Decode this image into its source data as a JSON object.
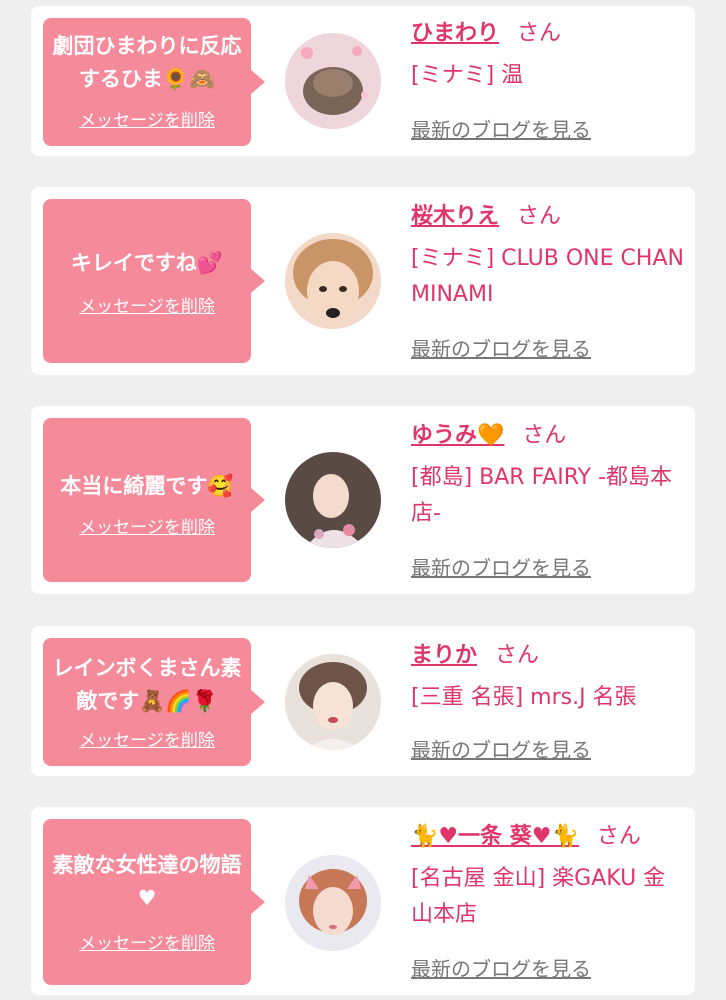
{
  "accent_color": "#e0356b",
  "bubble_color": "#f58a9a",
  "items": [
    {
      "message": "劇団ひまわりに反応するひま🌻🙈",
      "delete_label": "メッセージを削除",
      "name": "ひまわり",
      "honorific": "さん",
      "shop": "[ミナミ] 温",
      "blog_label": "最新のブログを見る"
    },
    {
      "message": "キレイですね💕",
      "delete_label": "メッセージを削除",
      "name": "桜木りえ",
      "honorific": "さん",
      "shop": "[ミナミ] CLUB ONE CHAN MINAMI",
      "blog_label": "最新のブログを見る"
    },
    {
      "message": "本当に綺麗です🥰",
      "delete_label": "メッセージを削除",
      "name": "ゆうみ🧡",
      "honorific": "さん",
      "shop": "[都島] BAR FAIRY -都島本店-",
      "blog_label": "最新のブログを見る"
    },
    {
      "message": "レインボくまさん素敵です🧸🌈🌹",
      "delete_label": "メッセージを削除",
      "name": "まりか",
      "honorific": "さん",
      "shop": "[三重 名張] mrs.J 名張",
      "blog_label": "最新のブログを見る"
    },
    {
      "message": "素敵な女性達の物語♥",
      "delete_label": "メッセージを削除",
      "name": "🐈♥一条 葵♥🐈",
      "honorific": "さん",
      "shop": "[名古屋 金山] 楽GAKU 金山本店",
      "blog_label": "最新のブログを見る"
    }
  ]
}
